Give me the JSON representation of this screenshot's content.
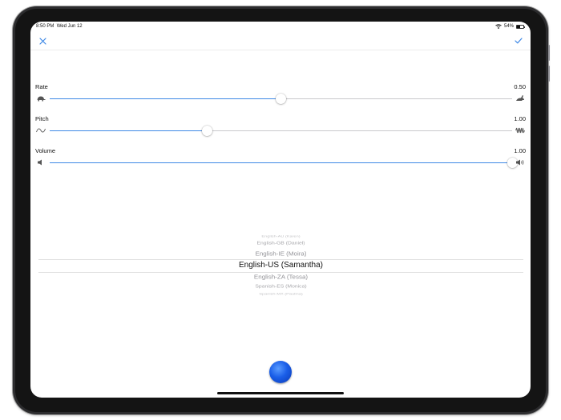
{
  "status_bar": {
    "time": "8:50 PM",
    "date": "Wed Jun 12",
    "battery_percent": "54%",
    "battery_level": 0.54
  },
  "nav": {
    "close_icon": "close-icon",
    "confirm_icon": "checkmark-icon"
  },
  "colors": {
    "accent": "#3e88e6",
    "record": "#1a5ee8"
  },
  "sliders": [
    {
      "label": "Rate",
      "value": "0.50",
      "fraction": 0.5,
      "min_icon": "turtle-icon",
      "max_icon": "hare-icon"
    },
    {
      "label": "Pitch",
      "value": "1.00",
      "fraction": 0.34,
      "min_icon": "low-wave-icon",
      "max_icon": "high-wave-icon"
    },
    {
      "label": "Volume",
      "value": "1.00",
      "fraction": 1.0,
      "min_icon": "speaker-low-icon",
      "max_icon": "speaker-high-icon"
    }
  ],
  "voice_picker": {
    "options": [
      "English-AU (Karen)",
      "English-GB (Daniel)",
      "English-IE (Moira)",
      "English-US (Samantha)",
      "English-ZA (Tessa)",
      "Spanish-ES (Monica)",
      "Spanish-MX (Paulina)"
    ],
    "selected_index": 3
  }
}
